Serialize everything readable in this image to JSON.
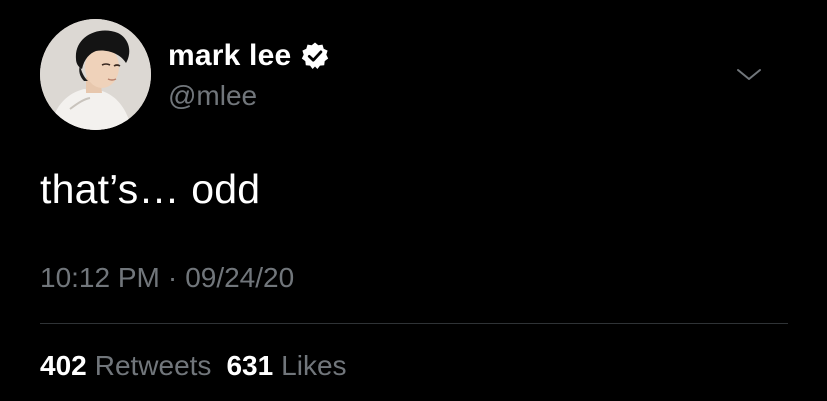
{
  "tweet": {
    "author": {
      "display_name": "mark lee",
      "handle": "@mlee",
      "verified": true
    },
    "text": "that’s… odd",
    "time": "10:12 PM",
    "separator": "·",
    "date": "09/24/20",
    "stats": {
      "retweets_count": "402",
      "retweets_label": "Retweets",
      "likes_count": "631",
      "likes_label": "Likes"
    }
  },
  "icons": {
    "verified": "verified-badge-icon",
    "menu": "chevron-down-icon"
  },
  "colors": {
    "background": "#000000",
    "primary_text": "#ffffff",
    "secondary_text": "#71767b",
    "divider": "#2f3336"
  }
}
